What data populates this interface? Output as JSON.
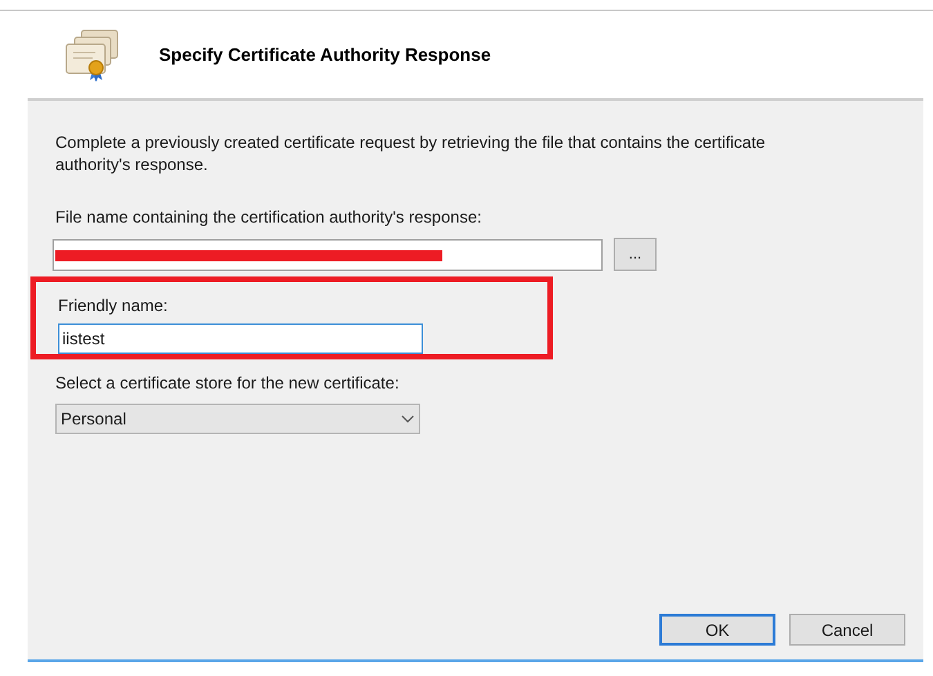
{
  "header": {
    "title": "Specify Certificate Authority Response"
  },
  "description": "Complete a previously created certificate request by retrieving the file that contains the certificate authority's response.",
  "file_field": {
    "label": "File name containing the certification authority's response:",
    "redacted": true,
    "browse_button": "..."
  },
  "friendly_name": {
    "label": "Friendly name:",
    "value": "iistest",
    "focused": true,
    "highlighted": true
  },
  "store": {
    "label": "Select a certificate store for the new certificate:",
    "value": "Personal"
  },
  "buttons": [
    {
      "label": "OK",
      "default": true
    },
    {
      "label": "Cancel",
      "default": false
    }
  ]
}
